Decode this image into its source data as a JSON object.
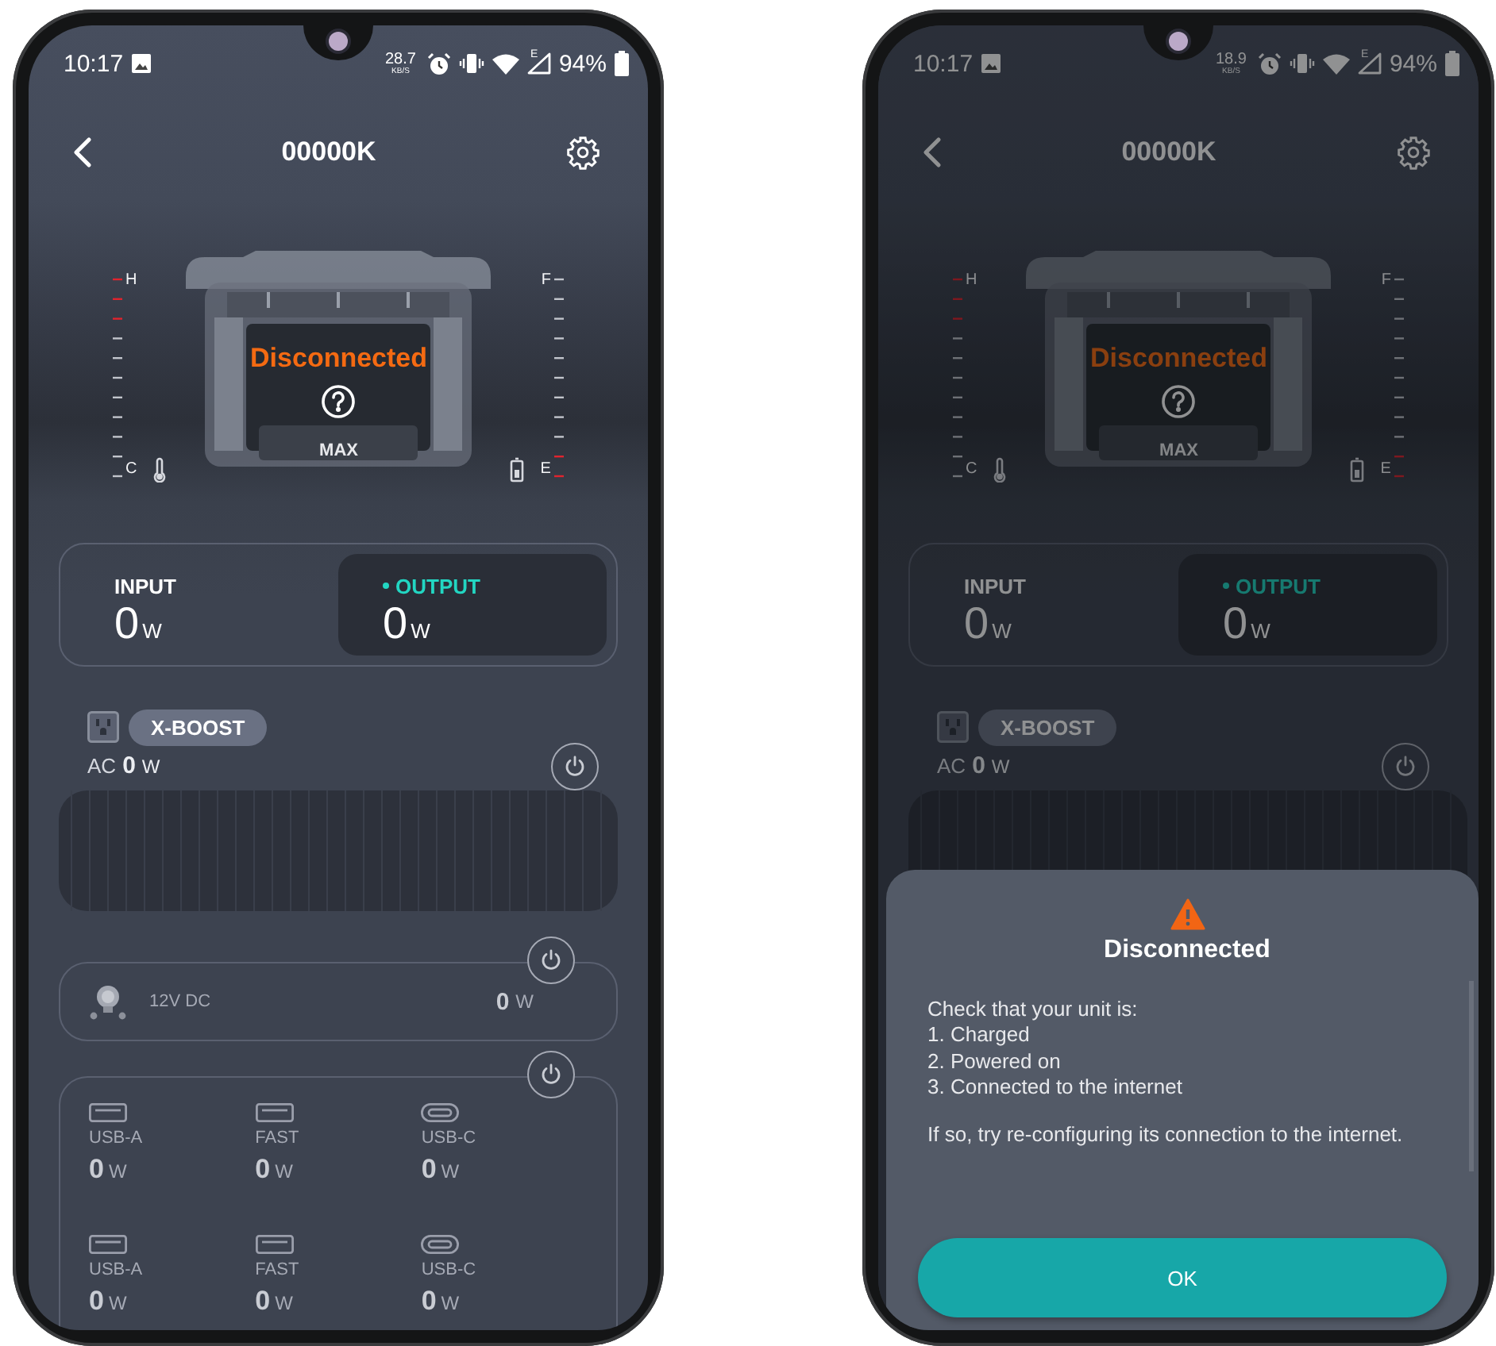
{
  "phones": [
    {
      "dimmed": false,
      "status_bar": {
        "time": "10:17",
        "net_speed": "28.7",
        "net_unit": "KB/S",
        "network_type": "E",
        "battery": "94%"
      },
      "header": {
        "title": "00000K"
      },
      "device": {
        "status": "Disconnected",
        "mode": "MAX",
        "temp_high": "H",
        "temp_low": "C",
        "charge_full": "F",
        "charge_empty": "E"
      },
      "flow": [
        {
          "label": "INPUT",
          "value": "0",
          "unit": "W",
          "selected": false
        },
        {
          "label": "OUTPUT",
          "value": "0",
          "unit": "W",
          "selected": true
        }
      ],
      "ac": {
        "badge": "X-BOOST",
        "label": "AC",
        "value": "0",
        "unit": "W"
      },
      "dc": {
        "label": "12V DC",
        "value": "0",
        "unit": "W"
      },
      "usb_ports": [
        {
          "kind": "usb-a",
          "label": "USB-A",
          "value": "0",
          "unit": "W"
        },
        {
          "kind": "fast",
          "label": "FAST",
          "value": "0",
          "unit": "W"
        },
        {
          "kind": "usb-c",
          "label": "USB-C",
          "value": "0",
          "unit": "W"
        },
        {
          "kind": "usb-a",
          "label": "USB-A",
          "value": "0",
          "unit": "W"
        },
        {
          "kind": "fast",
          "label": "FAST",
          "value": "0",
          "unit": "W"
        },
        {
          "kind": "usb-c",
          "label": "USB-C",
          "value": "0",
          "unit": "W"
        }
      ]
    },
    {
      "dimmed": true,
      "status_bar": {
        "time": "10:17",
        "net_speed": "18.9",
        "net_unit": "KB/S",
        "network_type": "E",
        "battery": "94%"
      },
      "header": {
        "title": "00000K"
      },
      "device": {
        "status": "Disconnected",
        "mode": "MAX",
        "temp_high": "H",
        "temp_low": "C",
        "charge_full": "F",
        "charge_empty": "E"
      },
      "flow": [
        {
          "label": "INPUT",
          "value": "0",
          "unit": "W",
          "selected": false
        },
        {
          "label": "OUTPUT",
          "value": "0",
          "unit": "W",
          "selected": true
        }
      ],
      "ac": {
        "badge": "X-BOOST",
        "label": "AC",
        "value": "0",
        "unit": "W"
      },
      "dialog": {
        "title": "Disconnected",
        "paragraphs": [
          "Check that your unit is:\n1. Charged\n2. Powered on\n3. Connected to the internet",
          "If so, try re-configuring its connection to the internet."
        ],
        "button": "OK"
      }
    }
  ]
}
